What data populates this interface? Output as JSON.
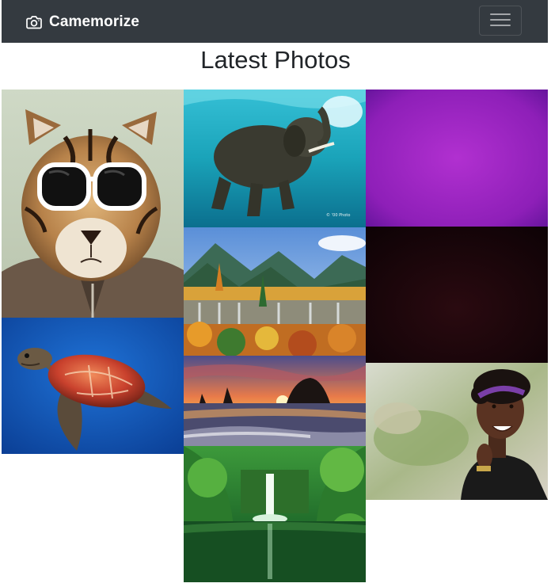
{
  "navbar": {
    "brand_name": "Camemorize",
    "brand_icon": "camera-icon",
    "toggler_icon": "hamburger-menu-icon"
  },
  "page": {
    "title": "Latest Photos"
  },
  "gallery": {
    "photos": [
      {
        "subject": "tiger wearing white sunglasses and leather jacket",
        "column": 1
      },
      {
        "subject": "sea turtle swimming in blue water",
        "column": 1
      },
      {
        "subject": "elephant swimming underwater",
        "column": 2
      },
      {
        "subject": "autumn valley with waterfalls and mountains",
        "column": 2
      },
      {
        "subject": "sunset over sea stack on beach",
        "column": 2
      },
      {
        "subject": "green forest waterfall",
        "column": 2
      },
      {
        "subject": "purple gradient",
        "column": 3
      },
      {
        "subject": "dark maroon gradient",
        "column": 3
      },
      {
        "subject": "smiling woman with headband",
        "column": 3
      }
    ]
  },
  "colors": {
    "navbar_bg": "#343a40",
    "page_bg": "#ffffff",
    "title_text": "#212529"
  }
}
